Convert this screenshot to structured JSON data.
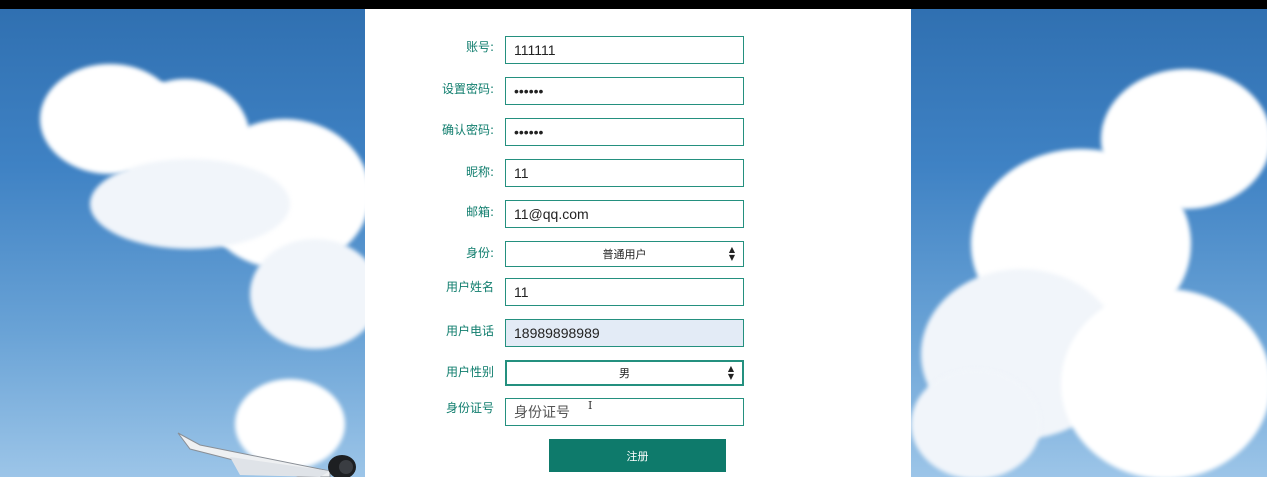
{
  "form": {
    "account": {
      "label": "账号:",
      "value": "111111"
    },
    "password": {
      "label": "设置密码:",
      "value": "••••••"
    },
    "confirm_password": {
      "label": "确认密码:",
      "value": "••••••"
    },
    "nickname": {
      "label": "昵称:",
      "value": "11"
    },
    "email": {
      "label": "邮箱:",
      "value": "11@qq.com"
    },
    "role": {
      "label": "身份:",
      "selected": "普通用户"
    },
    "user_name": {
      "label": "用户姓名",
      "value": "11"
    },
    "user_phone": {
      "label": "用户电话",
      "value": "18989898989"
    },
    "user_gender": {
      "label": "用户性别",
      "selected": "男"
    },
    "id_number": {
      "label": "身份证号",
      "placeholder": "身份证号"
    },
    "submit_label": "注册"
  },
  "icons": {
    "select_arrow": "select-arrows-icon",
    "text_cursor": "text-cursor-icon"
  },
  "colors": {
    "accent": "#0e7a6b",
    "label": "#0f7d6d",
    "field_border": "#24907f",
    "autofill_bg": "#e3ebf6"
  }
}
